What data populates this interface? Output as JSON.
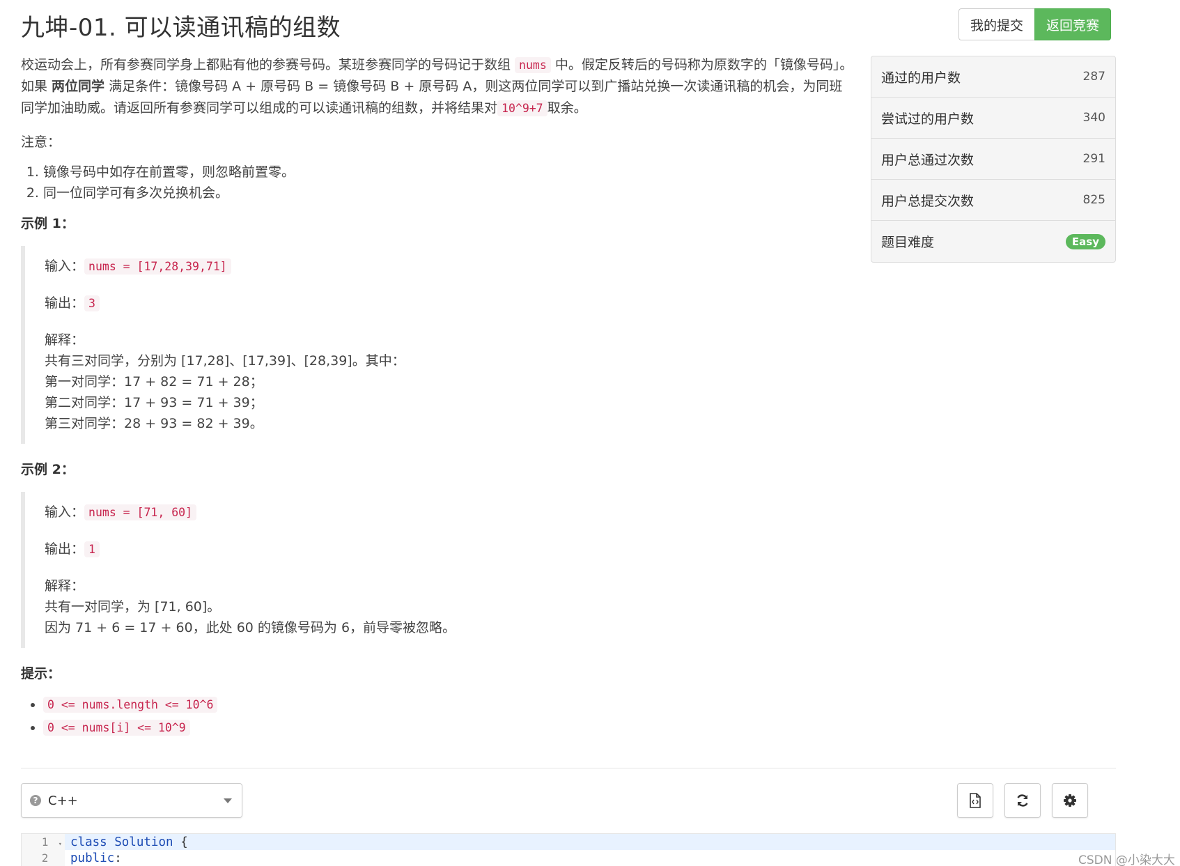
{
  "title": "九坤-01. 可以读通讯稿的组数",
  "buttons": {
    "my_submissions": "我的提交",
    "back_to_contest": "返回竞赛"
  },
  "description": {
    "p1_a": "校运动会上，所有参赛同学身上都贴有他的参赛号码。某班参赛同学的号码记于数组 ",
    "p1_code1": "nums",
    "p1_b": " 中。假定反转后的号码称为原数字的「镜像号码」。如果 ",
    "p1_bold": "两位同学",
    "p1_c": " 满足条件：镜像号码 A + 原号码 B = 镜像号码 B + 原号码 A，则这两位同学可以到广播站兑换一次读通讯稿的机会，为同班同学加油助威。请返回所有参赛同学可以组成的可以读通讯稿的组数，并将结果对",
    "p1_code2": "10^9+7",
    "p1_d": "取余。",
    "note_label": "注意：",
    "notes": [
      "镜像号码中如存在前置零，则忽略前置零。",
      "同一位同学可有多次兑换机会。"
    ]
  },
  "example1": {
    "heading": "示例 1：",
    "input_label": "输入：",
    "input_code": "nums = [17,28,39,71]",
    "output_label": "输出：",
    "output_code": "3",
    "explain_label": "解释：",
    "explain_lines": [
      "共有三对同学，分别为 [17,28]、[17,39]、[28,39]。其中：",
      "第一对同学：17 + 82 = 71 + 28；",
      "第二对同学：17 + 93 = 71 + 39；",
      "第三对同学：28 + 93 = 82 + 39。"
    ]
  },
  "example2": {
    "heading": "示例 2：",
    "input_label": "输入：",
    "input_code": "nums = [71, 60]",
    "output_label": "输出：",
    "output_code": "1",
    "explain_label": "解释：",
    "explain_lines": [
      "共有一对同学，为 [71, 60]。",
      "因为 71 + 6 = 17 + 60，此处 60 的镜像号码为 6，前导零被忽略。"
    ]
  },
  "hints": {
    "heading": "提示：",
    "items": [
      "0 <= nums.length <= 10^6",
      "0 <= nums[i] <= 10^9"
    ]
  },
  "stats": {
    "accepted_users_label": "通过的用户数",
    "accepted_users": "287",
    "tried_users_label": "尝试过的用户数",
    "tried_users": "340",
    "total_accepted_label": "用户总通过次数",
    "total_accepted": "291",
    "total_submissions_label": "用户总提交次数",
    "total_submissions": "825",
    "difficulty_label": "题目难度",
    "difficulty": "Easy",
    "difficulty_color": "#5cb85c"
  },
  "editor": {
    "language": "C++",
    "lines": [
      {
        "num": "1",
        "keyword": "class",
        "name": "Solution",
        "rest": " {"
      },
      {
        "num": "2",
        "keyword": "public",
        "name": "",
        "rest": ":"
      }
    ]
  },
  "icons": [
    "question-circle-icon",
    "chevron-down-icon",
    "file-code-icon",
    "refresh-icon",
    "gear-icon"
  ],
  "watermark": "CSDN @小染大大"
}
